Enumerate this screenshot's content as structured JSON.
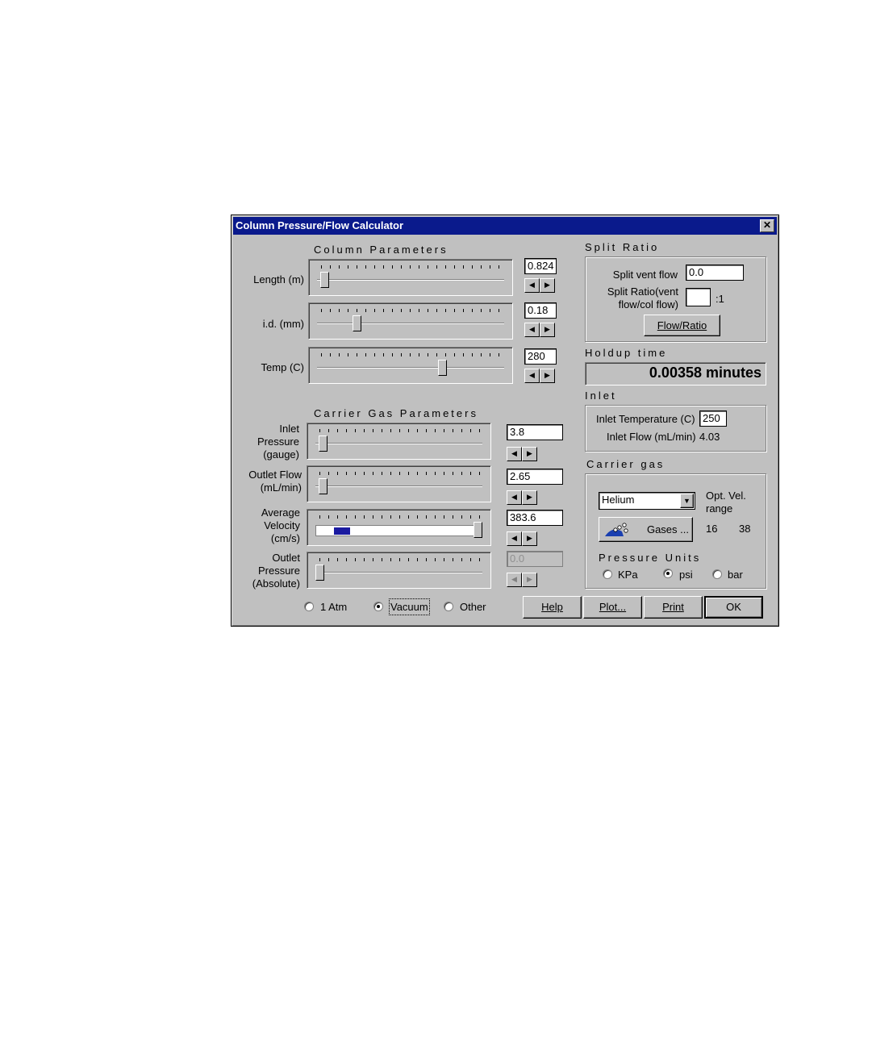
{
  "window": {
    "title": "Column Pressure/Flow Calculator",
    "close_glyph": "✕"
  },
  "column_params": {
    "title": "Column Parameters",
    "length": {
      "label": "Length (m)",
      "value": "0.824"
    },
    "id": {
      "label": "i.d. (mm)",
      "value": "0.18"
    },
    "temp": {
      "label": "Temp (C)",
      "value": "280"
    }
  },
  "carrier_params": {
    "title": "Carrier Gas Parameters",
    "inlet_pressure": {
      "label_1": "Inlet",
      "label_2": "Pressure",
      "label_3": "(gauge)",
      "value": "3.8"
    },
    "outlet_flow": {
      "label_1": "Outlet Flow",
      "label_2": "(mL/min)",
      "value": "2.65"
    },
    "avg_velocity": {
      "label_1": "Average",
      "label_2": "Velocity",
      "label_3": "(cm/s)",
      "value": "383.6"
    },
    "outlet_pressure": {
      "label_1": "Outlet",
      "label_2": "Pressure",
      "label_3": "(Absolute)",
      "value": "0.0"
    }
  },
  "outlet_mode": {
    "options": [
      "1 Atm",
      "Vacuum",
      "Other"
    ],
    "selected": "Vacuum"
  },
  "split_ratio": {
    "title": "Split Ratio",
    "vent_flow_label": "Split vent flow",
    "vent_flow_value": "0.0",
    "ratio_label_1": "Split Ratio(vent",
    "ratio_label_2": "flow/col flow)",
    "ratio_value": "",
    "ratio_suffix": ":1",
    "button": "Flow/Ratio"
  },
  "holdup": {
    "title": "Holdup time",
    "value": "0.00358 minutes"
  },
  "inlet": {
    "title": "Inlet",
    "temp_label": "Inlet Temperature (C)",
    "temp_value": "250",
    "flow_label": "Inlet Flow (mL/min)",
    "flow_value": "4.03"
  },
  "carrier_gas": {
    "title": "Carrier gas",
    "selected_gas": "Helium",
    "gases_button": "Gases ...",
    "opt_vel_label_1": "Opt. Vel.",
    "opt_vel_label_2": "range",
    "opt_vel_min": "16",
    "opt_vel_max": "38"
  },
  "pressure_units": {
    "title": "Pressure Units",
    "options": [
      "KPa",
      "psi",
      "bar"
    ],
    "selected": "psi"
  },
  "buttons": {
    "help": "Help",
    "plot": "Plot...",
    "print": "Print",
    "ok": "OK"
  },
  "sliders": {
    "length_fraction": 0.02,
    "id_fraction": 0.2,
    "temp_fraction": 0.68,
    "inlet_pressure_fraction": 0.02,
    "outlet_flow_fraction": 0.02,
    "avg_velocity_fraction": 1.0,
    "outlet_pressure_fraction": 0.0
  },
  "colors": {
    "titlebar": "#0a1a8c",
    "face": "#c0c0c0",
    "progress": "#1a1aa0"
  }
}
